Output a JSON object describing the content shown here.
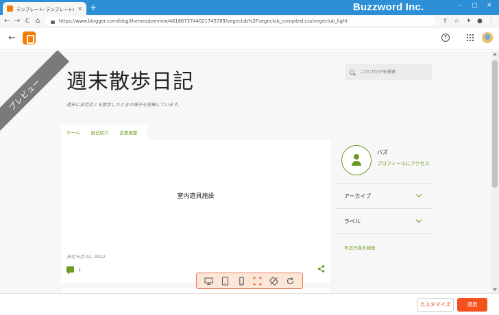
{
  "browser": {
    "tab_title": "テンプレート: テンプレートのプレビュー",
    "tab_close": "×",
    "new_tab": "+",
    "url": "https://www.blogger.com/blog/themes/preview/4618673744021745789/vegeclub%2Fvegeclub_compiled.css/vegeclub_light",
    "watermark": "Buzzword Inc.",
    "nav": {
      "back": "←",
      "forward": "→",
      "reload": "C",
      "home": "⌂"
    },
    "window": {
      "minimize": "–",
      "maximize": "□",
      "close": "×"
    }
  },
  "blogger_header": {
    "back": "←",
    "help": "?"
  },
  "preview": {
    "ribbon": "プレビュー",
    "blog_title": "週末散歩日記",
    "blog_description": "週末に自宅近くを散歩したときの様子を投稿しています。",
    "search_placeholder": "このブログを検索",
    "tabs": [
      "ホーム",
      "自己紹介",
      "変更履歴"
    ],
    "post": {
      "title": "室内遊具施設",
      "date": "日付 6月 01, 2022",
      "comment_count": "1"
    },
    "sidebar": {
      "profile_name": "バズ",
      "profile_link": "プロフィールにアクセス",
      "widgets": [
        "アーカイブ",
        "ラベル"
      ],
      "report": "不正行為を報告"
    }
  },
  "actions": {
    "customize": "カスタマイズ",
    "apply": "適用"
  },
  "colors": {
    "accent_green": "#6a9a1f",
    "apply_orange": "#f4511e",
    "chrome_blue": "#2d8fd6",
    "blogger_orange": "#f57c00"
  }
}
